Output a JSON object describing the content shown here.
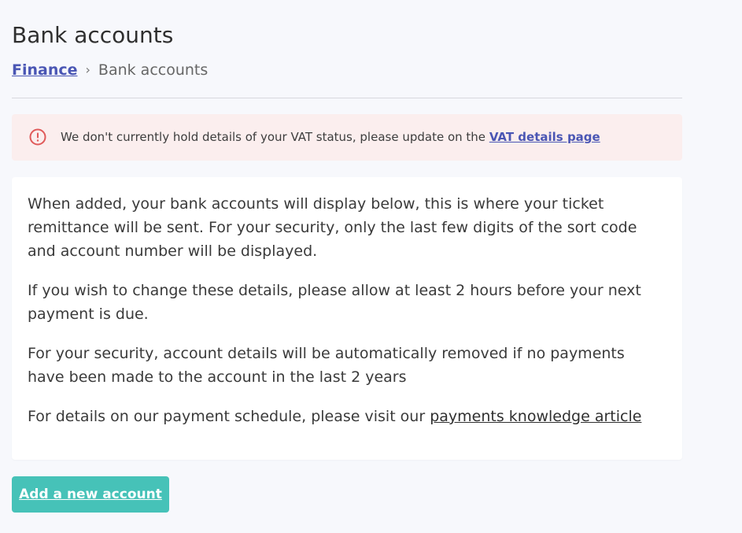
{
  "page": {
    "title": "Bank accounts"
  },
  "breadcrumb": {
    "parent": "Finance",
    "separator": "›",
    "current": "Bank accounts"
  },
  "alert": {
    "icon": "alert-circle-icon",
    "text": "We don't currently hold details of your VAT status, please update on the",
    "link_label": "VAT details page",
    "accent_color": "#e05a5a",
    "background_color": "#fbeeee"
  },
  "info": {
    "paragraph1": "When added, your bank accounts will display below, this is where your ticket remittance will be sent. For your security, only the last few digits of the sort code and account number will be displayed.",
    "paragraph2": "If you wish to change these details, please allow at least 2 hours before your next payment is due.",
    "paragraph3": "For your security, account details will be automatically removed if no payments have been made to the account in the last 2 years",
    "paragraph4_prefix": "For details on our payment schedule, please visit our",
    "paragraph4_link": "payments knowledge article"
  },
  "actions": {
    "add_account_label": "Add a new account",
    "button_color": "#46c2b8"
  },
  "colors": {
    "link": "#4a56b4",
    "page_background": "#f7f8fc"
  }
}
